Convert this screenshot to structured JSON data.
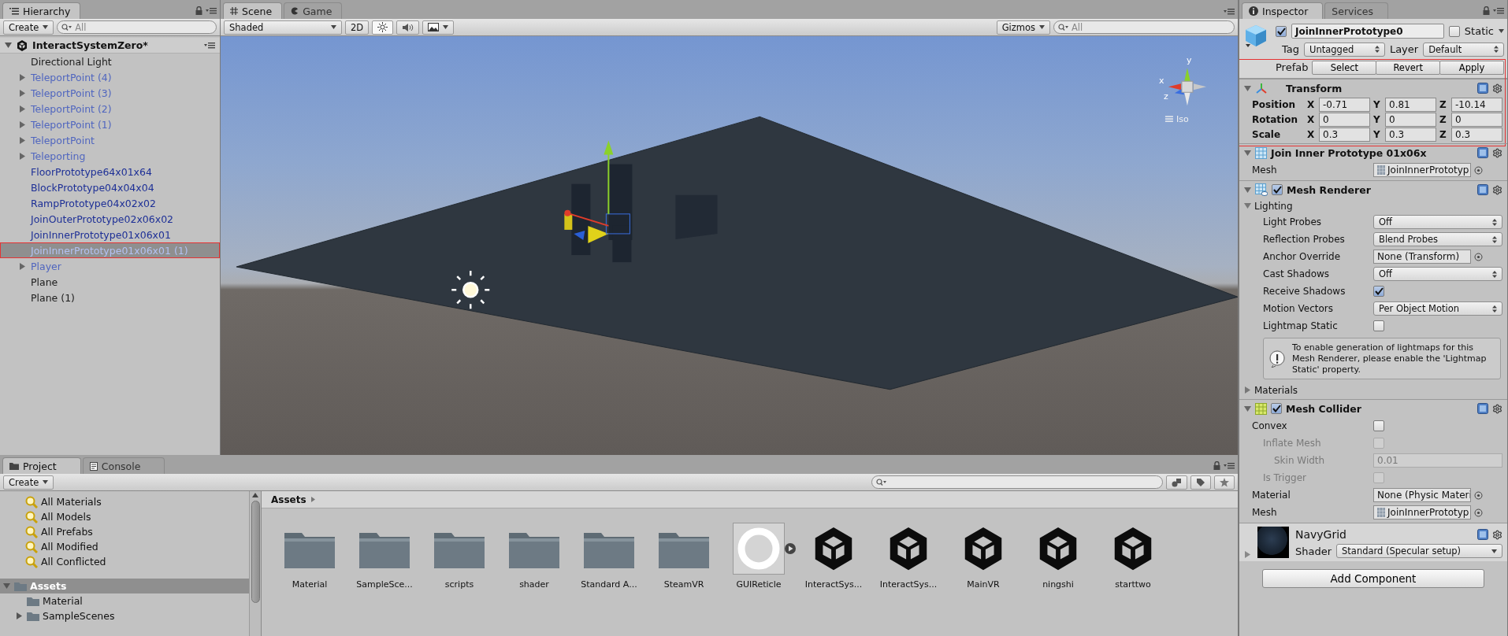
{
  "hierarchy": {
    "tab": "Hierarchy",
    "create": "Create",
    "search_placeholder": "All",
    "scene": {
      "name": "InteractSystemZero*",
      "expanded": true
    },
    "items": [
      {
        "label": "Directional Light",
        "kind": "object",
        "expandable": false,
        "selected": false,
        "marked": false
      },
      {
        "label": "TeleportPoint (4)",
        "kind": "prefab_light",
        "expandable": true,
        "selected": false,
        "marked": false
      },
      {
        "label": "TeleportPoint (3)",
        "kind": "prefab_light",
        "expandable": true,
        "selected": false,
        "marked": false
      },
      {
        "label": "TeleportPoint (2)",
        "kind": "prefab_light",
        "expandable": true,
        "selected": false,
        "marked": false
      },
      {
        "label": "TeleportPoint (1)",
        "kind": "prefab_light",
        "expandable": true,
        "selected": false,
        "marked": false
      },
      {
        "label": "TeleportPoint",
        "kind": "prefab_light",
        "expandable": true,
        "selected": false,
        "marked": false
      },
      {
        "label": "Teleporting",
        "kind": "prefab_light",
        "expandable": true,
        "selected": false,
        "marked": false
      },
      {
        "label": "FloorPrototype64x01x64",
        "kind": "prefab",
        "expandable": false,
        "selected": false,
        "marked": false
      },
      {
        "label": "BlockPrototype04x04x04",
        "kind": "prefab",
        "expandable": false,
        "selected": false,
        "marked": false
      },
      {
        "label": "RampPrototype04x02x02",
        "kind": "prefab",
        "expandable": false,
        "selected": false,
        "marked": false
      },
      {
        "label": "JoinOuterPrototype02x06x02",
        "kind": "prefab",
        "expandable": false,
        "selected": false,
        "marked": false
      },
      {
        "label": "JoinInnerPrototype01x06x01",
        "kind": "prefab",
        "expandable": false,
        "selected": false,
        "marked": false
      },
      {
        "label": "JoinInnerPrototype01x06x01 (1)",
        "kind": "prefab",
        "expandable": false,
        "selected": true,
        "marked": true
      },
      {
        "label": "Player",
        "kind": "prefab_light",
        "expandable": true,
        "selected": false,
        "marked": false
      },
      {
        "label": "Plane",
        "kind": "object",
        "expandable": false,
        "selected": false,
        "marked": false
      },
      {
        "label": "Plane (1)",
        "kind": "object",
        "expandable": false,
        "selected": false,
        "marked": false
      }
    ]
  },
  "scene": {
    "tabs": [
      {
        "label": "Scene",
        "selected": true
      },
      {
        "label": "Game",
        "selected": false
      }
    ],
    "shading": "Shaded",
    "mode_2d": "2D",
    "lighting_on": true,
    "audio_on": false,
    "gizmos": "Gizmos",
    "search_placeholder": "All",
    "gizmo": {
      "axes": [
        "y",
        "x",
        "z"
      ],
      "projection": "Iso"
    }
  },
  "inspector": {
    "tabs": [
      {
        "label": "Inspector",
        "selected": true
      },
      {
        "label": "Services",
        "selected": false
      }
    ],
    "object": {
      "active": true,
      "name": "JoinInnerPrototype0",
      "static": false,
      "static_label": "Static",
      "tag_label": "Tag",
      "tag": "Untagged",
      "layer_label": "Layer",
      "layer": "Default",
      "prefab_label": "Prefab",
      "prefab_buttons": [
        "Select",
        "Revert",
        "Apply"
      ]
    },
    "components": [
      {
        "kind": "transform",
        "title": "Transform",
        "expanded": true,
        "marked": true,
        "rows": [
          {
            "label": "Position",
            "values": [
              {
                "axis": "X",
                "value": "-0.71"
              },
              {
                "axis": "Y",
                "value": "0.81"
              },
              {
                "axis": "Z",
                "value": "-10.14"
              }
            ]
          },
          {
            "label": "Rotation",
            "values": [
              {
                "axis": "X",
                "value": "0"
              },
              {
                "axis": "Y",
                "value": "0"
              },
              {
                "axis": "Z",
                "value": "0"
              }
            ]
          },
          {
            "label": "Scale",
            "values": [
              {
                "axis": "X",
                "value": "0.3"
              },
              {
                "axis": "Y",
                "value": "0.3"
              },
              {
                "axis": "Z",
                "value": "0.3"
              }
            ]
          }
        ]
      },
      {
        "kind": "mesh_filter",
        "title": "Join Inner Prototype 01x06x",
        "expanded": true,
        "marked": false,
        "fields": [
          {
            "kind": "asset",
            "label": "Mesh",
            "value": "JoinInnerPrototyp",
            "disabled": false
          }
        ]
      },
      {
        "kind": "mesh_renderer",
        "title": "Mesh Renderer",
        "expanded": true,
        "enabled": true,
        "marked": false,
        "sections": [
          {
            "label": "Lighting",
            "expanded": true,
            "fields": [
              {
                "kind": "dropdown",
                "label": "Light Probes",
                "value": "Off",
                "disabled": false
              },
              {
                "kind": "dropdown",
                "label": "Reflection Probes",
                "value": "Blend Probes",
                "disabled": false
              },
              {
                "kind": "object",
                "label": "Anchor Override",
                "value": "None (Transform)",
                "disabled": false
              },
              {
                "kind": "dropdown",
                "label": "Cast Shadows",
                "value": "Off",
                "disabled": false
              },
              {
                "kind": "checkbox",
                "label": "Receive Shadows",
                "checked": true,
                "disabled": false
              },
              {
                "kind": "dropdown",
                "label": "Motion Vectors",
                "value": "Per Object Motion",
                "disabled": false
              },
              {
                "kind": "checkbox",
                "label": "Lightmap Static",
                "checked": false,
                "disabled": false
              }
            ],
            "help": "To enable generation of lightmaps for this Mesh Renderer, please enable the 'Lightmap Static' property."
          },
          {
            "label": "Materials",
            "expanded": false
          }
        ]
      },
      {
        "kind": "mesh_collider",
        "title": "Mesh Collider",
        "expanded": true,
        "enabled": true,
        "marked": false,
        "fields": [
          {
            "kind": "checkbox",
            "label": "Convex",
            "checked": false,
            "disabled": false,
            "children": [
              {
                "kind": "checkbox",
                "label": "Inflate Mesh",
                "checked": false,
                "disabled": true,
                "children": [
                  {
                    "kind": "number",
                    "label": "Skin Width",
                    "value": "0.01",
                    "disabled": true
                  }
                ]
              },
              {
                "kind": "checkbox",
                "label": "Is Trigger",
                "checked": false,
                "disabled": true
              }
            ]
          },
          {
            "kind": "object",
            "label": "Material",
            "value": "None (Physic Materi",
            "disabled": false
          },
          {
            "kind": "asset",
            "label": "Mesh",
            "value": "JoinInnerPrototyp",
            "disabled": false
          }
        ]
      },
      {
        "kind": "material",
        "title": "NavyGrid",
        "expanded": false,
        "marked": false,
        "shader_label": "Shader",
        "shader": "Standard (Specular setup)"
      }
    ],
    "add_component": "Add Component"
  },
  "project": {
    "tabs": [
      {
        "label": "Project",
        "selected": true
      },
      {
        "label": "Console",
        "selected": false
      }
    ],
    "create": "Create",
    "favorites": [
      "All Materials",
      "All Models",
      "All Prefabs",
      "All Modified",
      "All Conflicted"
    ],
    "tree": [
      {
        "label": "Assets",
        "expandable": true,
        "expanded": true,
        "selected": true,
        "children": [
          {
            "label": "Material",
            "expandable": false,
            "expanded": false,
            "selected": false
          },
          {
            "label": "SampleScenes",
            "expandable": true,
            "expanded": false,
            "selected": false
          }
        ]
      }
    ],
    "breadcrumb": "Assets",
    "assets": [
      {
        "name": "Material",
        "kind": "folder"
      },
      {
        "name": "SampleSce...",
        "kind": "folder"
      },
      {
        "name": "scripts",
        "kind": "folder"
      },
      {
        "name": "shader",
        "kind": "folder"
      },
      {
        "name": "Standard A...",
        "kind": "folder"
      },
      {
        "name": "SteamVR",
        "kind": "folder"
      },
      {
        "name": "GUIReticle",
        "kind": "texture"
      },
      {
        "name": "InteractSys...",
        "kind": "scene"
      },
      {
        "name": "InteractSys...",
        "kind": "scene"
      },
      {
        "name": "MainVR",
        "kind": "scene"
      },
      {
        "name": "ningshi",
        "kind": "scene"
      },
      {
        "name": "starttwo",
        "kind": "scene"
      }
    ]
  }
}
